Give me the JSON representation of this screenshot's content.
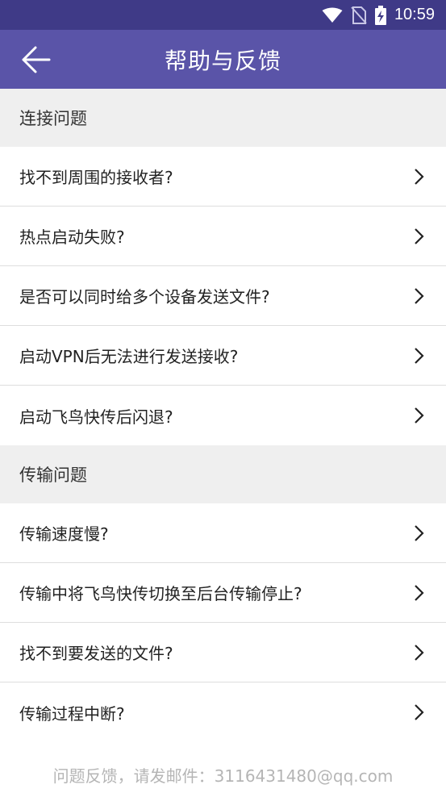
{
  "status_bar": {
    "time": "10:59"
  },
  "header": {
    "title": "帮助与反馈"
  },
  "sections": [
    {
      "title": "连接问题",
      "items": [
        {
          "label": "找不到周围的接收者?"
        },
        {
          "label": "热点启动失败?"
        },
        {
          "label": "是否可以同时给多个设备发送文件?"
        },
        {
          "label": "启动VPN后无法进行发送接收?"
        },
        {
          "label": "启动飞鸟快传后闪退?"
        }
      ]
    },
    {
      "title": "传输问题",
      "items": [
        {
          "label": "传输速度慢?"
        },
        {
          "label": "传输中将飞鸟快传切换至后台传输停止?"
        },
        {
          "label": "找不到要发送的文件?"
        },
        {
          "label": "传输过程中断?"
        }
      ]
    }
  ],
  "footer": {
    "text": "问题反馈，请发邮件：3116431480@qq.com"
  },
  "colors": {
    "status_bar": "#3f3a87",
    "app_bar": "#5a54a8",
    "section_bg": "#efefef"
  }
}
